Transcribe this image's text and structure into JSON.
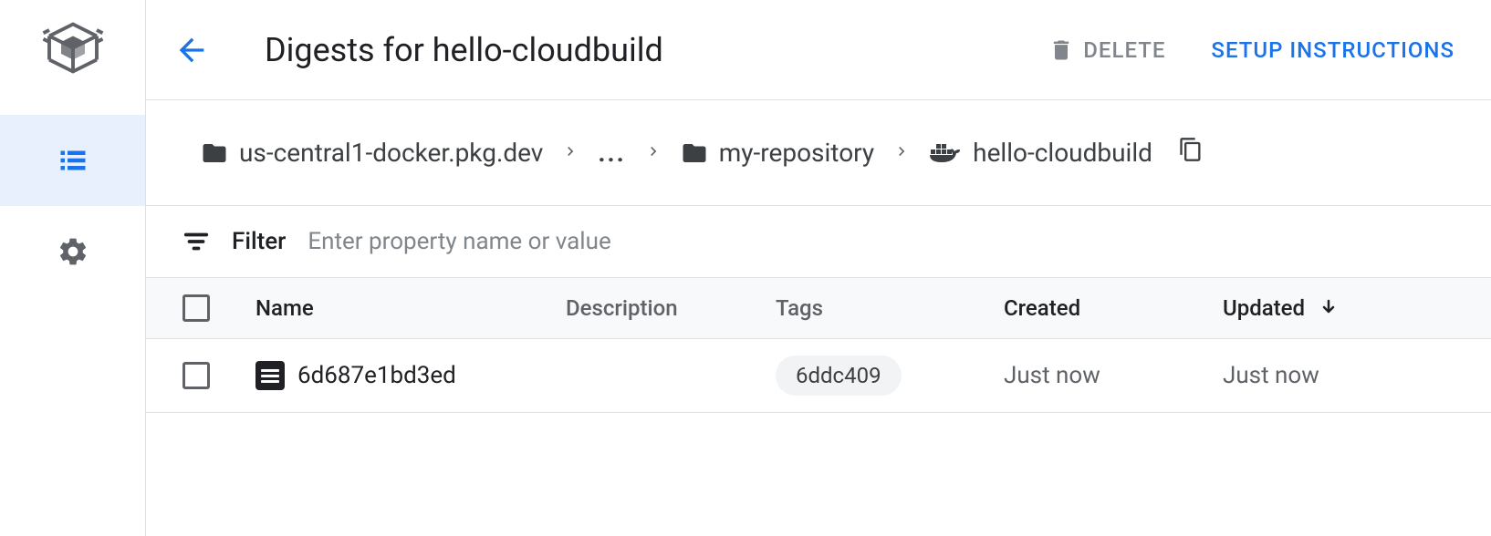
{
  "header": {
    "title": "Digests for hello-cloudbuild",
    "delete_label": "DELETE",
    "setup_label": "SETUP INSTRUCTIONS"
  },
  "breadcrumb": {
    "items": [
      {
        "label": "us-central1-docker.pkg.dev",
        "icon": "folder"
      },
      {
        "label": "...",
        "icon": "dots"
      },
      {
        "label": "my-repository",
        "icon": "folder"
      },
      {
        "label": "hello-cloudbuild",
        "icon": "docker"
      }
    ]
  },
  "filter": {
    "label": "Filter",
    "placeholder": "Enter property name or value"
  },
  "table": {
    "columns": {
      "name": "Name",
      "description": "Description",
      "tags": "Tags",
      "created": "Created",
      "updated": "Updated"
    },
    "rows": [
      {
        "name": "6d687e1bd3ed",
        "description": "",
        "tags": [
          "6ddc409"
        ],
        "created": "Just now",
        "updated": "Just now"
      }
    ]
  }
}
